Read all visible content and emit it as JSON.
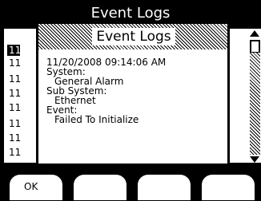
{
  "screen": {
    "title": "Event Logs"
  },
  "list": {
    "items": [
      "11",
      "11",
      "11",
      "11",
      "11",
      "11",
      "11",
      "11"
    ]
  },
  "dialog": {
    "title": "Event Logs",
    "timestamp": "11/20/2008  09:14:06 AM",
    "system_label": "System:",
    "system_value": "General Alarm",
    "subsystem_label": "Sub System:",
    "subsystem_value": "Ethernet",
    "event_label": "Event:",
    "event_value": "Failed To Initialize"
  },
  "softkeys": {
    "labels": [
      "OK",
      "",
      "",
      ""
    ]
  }
}
